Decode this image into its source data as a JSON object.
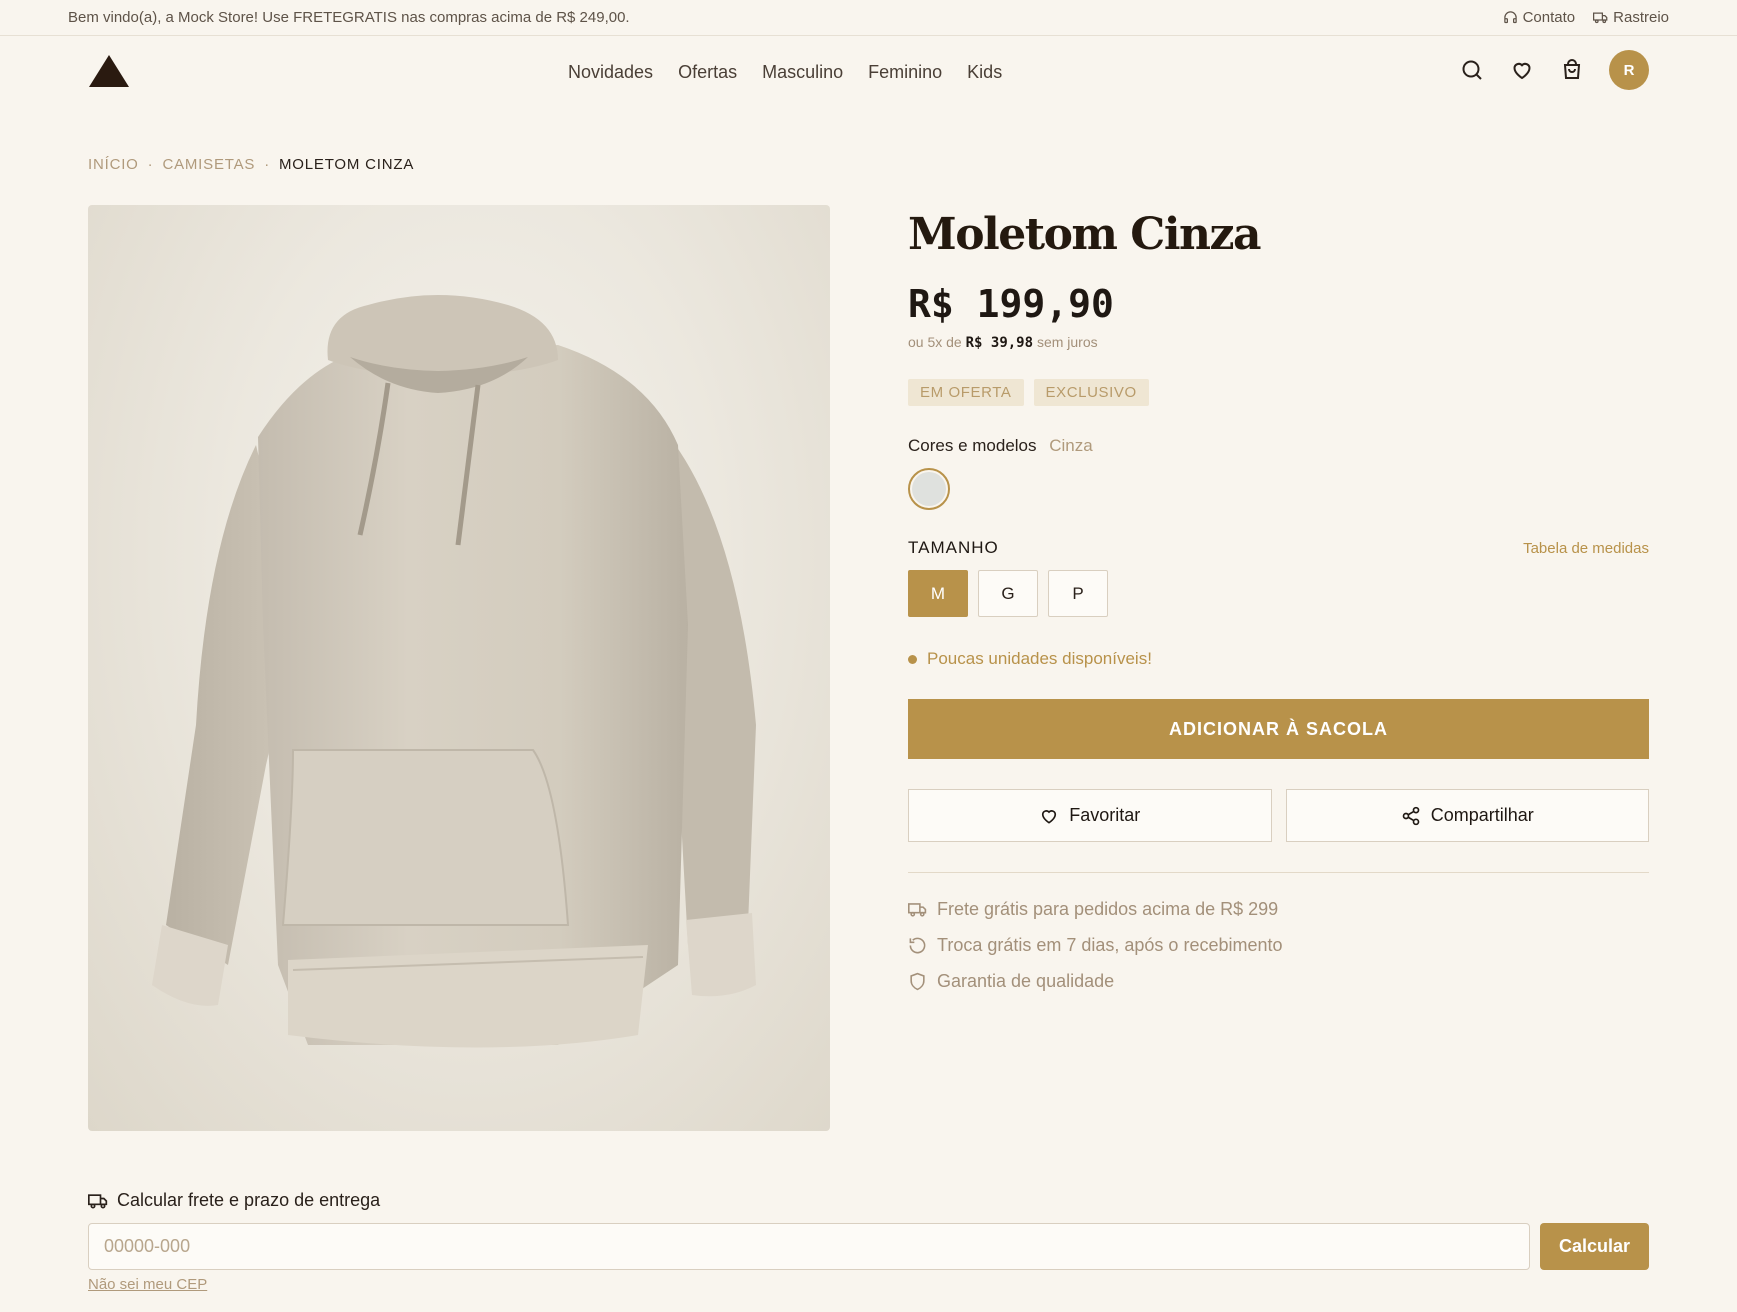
{
  "topbar": {
    "announcement": "Bem vindo(a), a Mock Store! Use FRETEGRATIS nas compras acima de R$ 249,00.",
    "contact": "Contato",
    "tracking": "Rastreio"
  },
  "header": {
    "nav": [
      "Novidades",
      "Ofertas",
      "Masculino",
      "Feminino",
      "Kids"
    ],
    "avatar_initial": "R",
    "icons": [
      "search-icon",
      "heart-icon",
      "bag-icon"
    ]
  },
  "breadcrumb": {
    "items": [
      "INÍCIO",
      "CAMISETAS",
      "MOLETOM CINZA"
    ],
    "separator": "·"
  },
  "product": {
    "title": "Moletom Cinza",
    "price": "R$ 199,90",
    "installments_prefix": "ou 5x de",
    "installments_value": "R$ 39,98",
    "installments_suffix": "sem juros",
    "badges": [
      "EM OFERTA",
      "EXCLUSIVO"
    ],
    "colors_label": "Cores e modelos",
    "color_selected": "Cinza",
    "swatch_color": "#dfe1de",
    "size_label": "TAMANHO",
    "size_guide": "Tabela de medidas",
    "sizes": [
      "M",
      "G",
      "P"
    ],
    "size_selected": "M",
    "stock_message": "Poucas unidades disponíveis!",
    "add_to_bag": "ADICIONAR À SACOLA",
    "favorite": "Favoritar",
    "share": "Compartilhar",
    "perks": [
      "Frete grátis para pedidos acima de R$ 299",
      "Troca grátis em 7 dias, após o recebimento",
      "Garantia de qualidade"
    ]
  },
  "shipping": {
    "title": "Calcular frete e prazo de entrega",
    "placeholder": "00000-000",
    "button": "Calcular",
    "help_link": "Não sei meu CEP"
  },
  "colors": {
    "accent": "#b8924a",
    "background": "#f9f5ee",
    "text": "#2a211b"
  }
}
